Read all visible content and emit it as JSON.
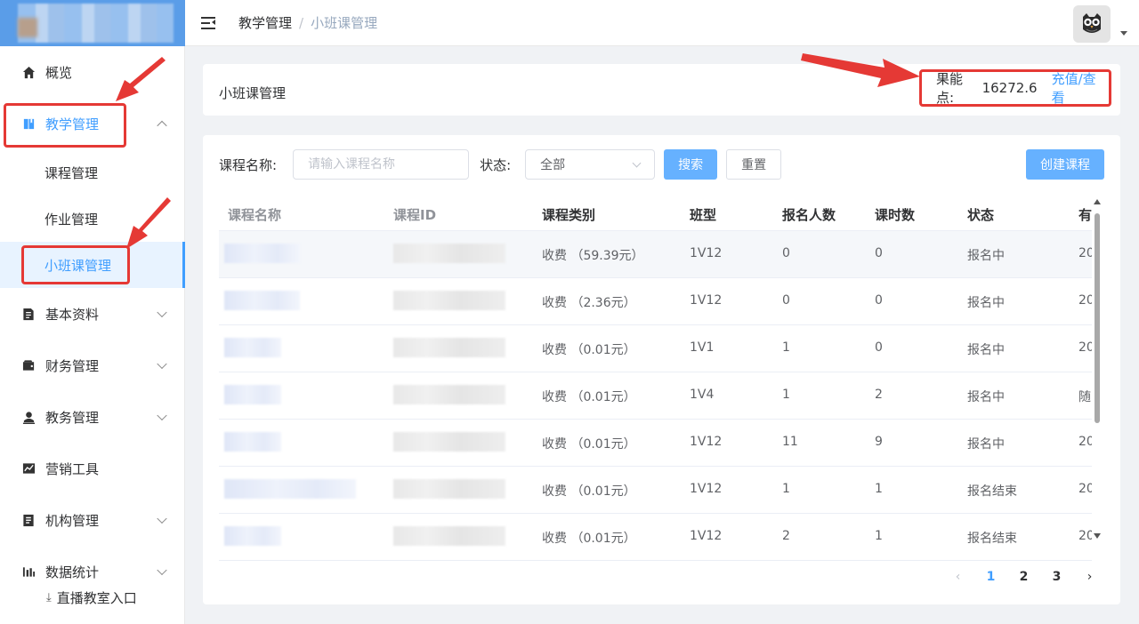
{
  "sidebar": {
    "items": [
      {
        "label": "概览",
        "icon": "home-icon"
      },
      {
        "label": "教学管理",
        "icon": "book-icon",
        "expanded": true,
        "children": [
          {
            "label": "课程管理"
          },
          {
            "label": "作业管理"
          },
          {
            "label": "小班课管理",
            "selected": true
          }
        ]
      },
      {
        "label": "基本资料",
        "icon": "document-icon"
      },
      {
        "label": "财务管理",
        "icon": "wallet-icon"
      },
      {
        "label": "教务管理",
        "icon": "user-stamp-icon"
      },
      {
        "label": "营销工具",
        "icon": "chart-line-icon"
      },
      {
        "label": "机构管理",
        "icon": "building-icon"
      },
      {
        "label": "数据统计",
        "icon": "bar-chart-icon"
      }
    ],
    "live_entry": "直播教室入口"
  },
  "header": {
    "breadcrumb": [
      "教学管理",
      "小班课管理"
    ],
    "separator": "/"
  },
  "title_card": {
    "title": "小班课管理",
    "points_label": "果能点:",
    "points_value": "16272.6",
    "recharge_link": "充值/查看"
  },
  "filter": {
    "name_label": "课程名称:",
    "name_placeholder": "请输入课程名称",
    "status_label": "状态:",
    "status_value": "全部",
    "search_btn": "搜索",
    "reset_btn": "重置",
    "create_btn": "创建课程"
  },
  "table": {
    "columns": [
      "课程名称",
      "课程ID",
      "课程类别",
      "班型",
      "报名人数",
      "课时数",
      "状态",
      "有"
    ],
    "rows": [
      {
        "category": "收费 （59.39元）",
        "class_type": "1V12",
        "enrolled": "0",
        "lessons": "0",
        "status": "报名中",
        "extra": "20"
      },
      {
        "category": "收费 （2.36元）",
        "class_type": "1V12",
        "enrolled": "0",
        "lessons": "0",
        "status": "报名中",
        "extra": "20"
      },
      {
        "category": "收费 （0.01元）",
        "class_type": "1V1",
        "enrolled": "1",
        "lessons": "0",
        "status": "报名中",
        "extra": "20"
      },
      {
        "category": "收费 （0.01元）",
        "class_type": "1V4",
        "enrolled": "1",
        "lessons": "2",
        "status": "报名中",
        "extra": "随"
      },
      {
        "category": "收费 （0.01元）",
        "class_type": "1V12",
        "enrolled": "11",
        "lessons": "9",
        "status": "报名中",
        "extra": "20"
      },
      {
        "category": "收费 （0.01元）",
        "class_type": "1V12",
        "enrolled": "1",
        "lessons": "1",
        "status": "报名结束",
        "extra": "20"
      },
      {
        "category": "收费 （0.01元）",
        "class_type": "1V12",
        "enrolled": "2",
        "lessons": "1",
        "status": "报名结束",
        "extra": "20"
      }
    ]
  },
  "pagination": {
    "prev": "‹",
    "pages": [
      "1",
      "2",
      "3"
    ],
    "current": "1",
    "next": "›"
  },
  "colors": {
    "accent": "#409eff",
    "annotation_red": "#e53935"
  }
}
